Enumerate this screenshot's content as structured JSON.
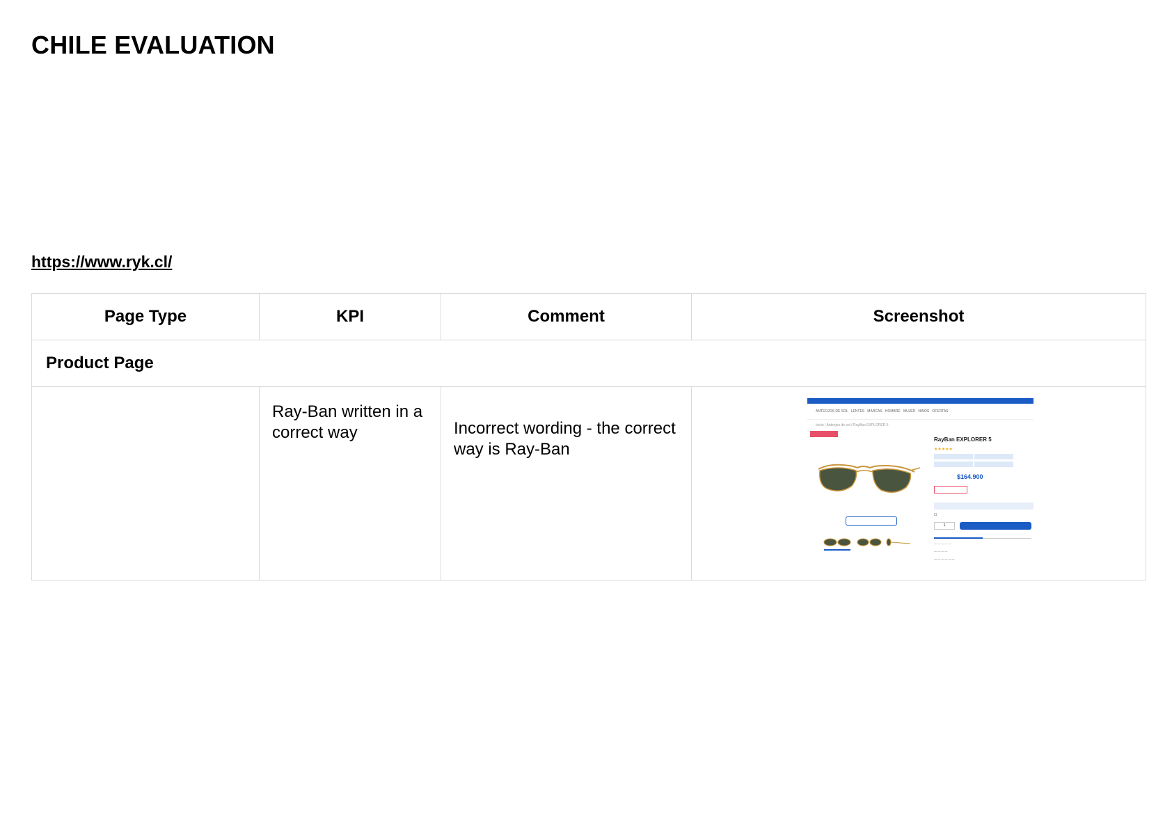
{
  "document": {
    "title": "CHILE EVALUATION",
    "link": "https://www.ryk.cl/"
  },
  "table": {
    "headers": [
      "Page Type",
      "KPI",
      "Comment",
      "Screenshot"
    ],
    "section": "Product Page",
    "rows": [
      {
        "page_type": "",
        "kpi": "Ray-Ban written in a correct way",
        "comment": "Incorrect wording - the correct way is Ray-Ban"
      }
    ]
  },
  "screenshot": {
    "price": "$164.900",
    "product_title": "RayBan EXPLORER 5",
    "colors": {
      "brand_blue": "#1a5bc4",
      "badge_pink": "#e8506a"
    }
  }
}
